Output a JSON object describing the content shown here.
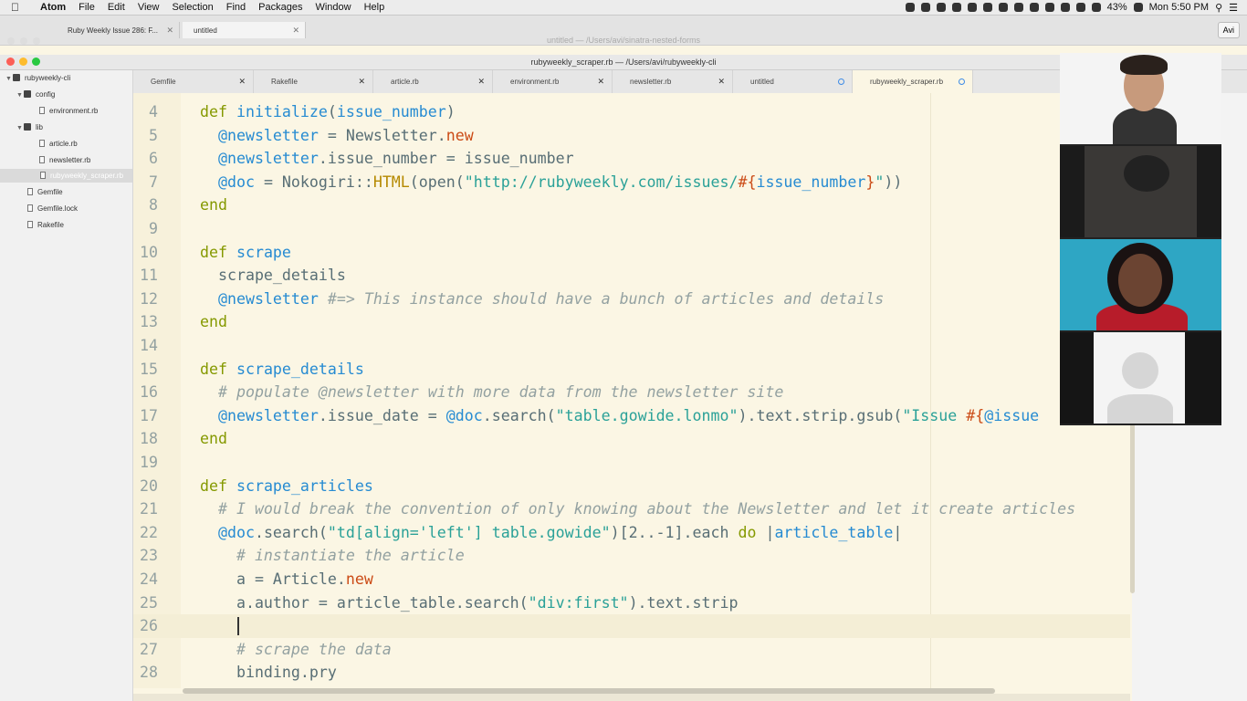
{
  "menubar": {
    "app": "Atom",
    "items": [
      "File",
      "Edit",
      "View",
      "Selection",
      "Find",
      "Packages",
      "Window",
      "Help"
    ],
    "battery": "43%",
    "clock": "Mon 5:50 PM"
  },
  "browser": {
    "tabs": [
      {
        "label": "Ruby Weekly Issue 286: F..."
      },
      {
        "label": "untitled"
      }
    ],
    "profile": "Avi",
    "untitled_path": "untitled — /Users/avi/sinatra-nested-forms"
  },
  "atom": {
    "window_title": "rubyweekly_scraper.rb — /Users/avi/rubyweekly-cli",
    "tree": {
      "root": "rubyweekly-cli",
      "config": "config",
      "environment": "environment.rb",
      "lib": "lib",
      "article": "article.rb",
      "newsletter": "newsletter.rb",
      "scraper": "rubyweekly_scraper.rb",
      "gemfile": "Gemfile",
      "gemfile_lock": "Gemfile.lock",
      "rakefile": "Rakefile"
    },
    "tabs": [
      "Gemfile",
      "Rakefile",
      "article.rb",
      "environment.rb",
      "newsletter.rb",
      "untitled",
      "rubyweekly_scraper.rb"
    ]
  },
  "editor": {
    "lines": [
      {
        "n": "4",
        "code": [
          {
            "t": "def ",
            "c": "kw"
          },
          {
            "t": "initialize",
            "c": "fn"
          },
          {
            "t": "(",
            "c": ""
          },
          {
            "t": "issue_number",
            "c": "fn"
          },
          {
            "t": ")",
            "c": ""
          }
        ]
      },
      {
        "n": "5",
        "code": [
          {
            "t": "  ",
            "c": ""
          },
          {
            "t": "@newsletter",
            "c": "iv"
          },
          {
            "t": " = Newsletter.",
            "c": ""
          },
          {
            "t": "new",
            "c": "red"
          }
        ]
      },
      {
        "n": "6",
        "code": [
          {
            "t": "  ",
            "c": ""
          },
          {
            "t": "@newsletter",
            "c": "iv"
          },
          {
            "t": ".issue_number = issue_number",
            "c": ""
          }
        ]
      },
      {
        "n": "7",
        "code": [
          {
            "t": "  ",
            "c": ""
          },
          {
            "t": "@doc",
            "c": "iv"
          },
          {
            "t": " = Nokogiri::",
            "c": ""
          },
          {
            "t": "HTML",
            "c": "cls"
          },
          {
            "t": "(open(",
            "c": ""
          },
          {
            "t": "\"http://rubyweekly.com/issues/",
            "c": "str"
          },
          {
            "t": "#{",
            "c": "red"
          },
          {
            "t": "issue_number",
            "c": "fn"
          },
          {
            "t": "}",
            "c": "red"
          },
          {
            "t": "\"",
            "c": "str"
          },
          {
            "t": "))",
            "c": ""
          }
        ]
      },
      {
        "n": "8",
        "code": [
          {
            "t": "end",
            "c": "kw"
          }
        ]
      },
      {
        "n": "9",
        "code": []
      },
      {
        "n": "10",
        "code": [
          {
            "t": "def ",
            "c": "kw"
          },
          {
            "t": "scrape",
            "c": "fn"
          }
        ]
      },
      {
        "n": "11",
        "code": [
          {
            "t": "  scrape_details",
            "c": ""
          }
        ]
      },
      {
        "n": "12",
        "code": [
          {
            "t": "  ",
            "c": ""
          },
          {
            "t": "@newsletter",
            "c": "iv"
          },
          {
            "t": " #=> This instance should have a bunch of articles and details",
            "c": "cm"
          }
        ]
      },
      {
        "n": "13",
        "code": [
          {
            "t": "end",
            "c": "kw"
          }
        ]
      },
      {
        "n": "14",
        "code": []
      },
      {
        "n": "15",
        "code": [
          {
            "t": "def ",
            "c": "kw"
          },
          {
            "t": "scrape_details",
            "c": "fn"
          }
        ]
      },
      {
        "n": "16",
        "code": [
          {
            "t": "  # populate @newsletter with more data from the newsletter site",
            "c": "cm"
          }
        ]
      },
      {
        "n": "17",
        "code": [
          {
            "t": "  ",
            "c": ""
          },
          {
            "t": "@newsletter",
            "c": "iv"
          },
          {
            "t": ".issue_date = ",
            "c": ""
          },
          {
            "t": "@doc",
            "c": "iv"
          },
          {
            "t": ".search(",
            "c": ""
          },
          {
            "t": "\"table.gowide.lonmo\"",
            "c": "str"
          },
          {
            "t": ").text.strip.gsub(",
            "c": ""
          },
          {
            "t": "\"Issue ",
            "c": "str"
          },
          {
            "t": "#{",
            "c": "red"
          },
          {
            "t": "@issue",
            "c": "iv"
          }
        ]
      },
      {
        "n": "18",
        "code": [
          {
            "t": "end",
            "c": "kw"
          }
        ]
      },
      {
        "n": "19",
        "code": []
      },
      {
        "n": "20",
        "code": [
          {
            "t": "def ",
            "c": "kw"
          },
          {
            "t": "scrape_articles",
            "c": "fn"
          }
        ]
      },
      {
        "n": "21",
        "code": [
          {
            "t": "  # I would break the convention of only knowing about the Newsletter and let it create articles",
            "c": "cm"
          }
        ]
      },
      {
        "n": "22",
        "code": [
          {
            "t": "  ",
            "c": ""
          },
          {
            "t": "@doc",
            "c": "iv"
          },
          {
            "t": ".search(",
            "c": ""
          },
          {
            "t": "\"td[align='left'] table.gowide\"",
            "c": "str"
          },
          {
            "t": ")[2..-1].each ",
            "c": ""
          },
          {
            "t": "do",
            "c": "kw"
          },
          {
            "t": " |",
            "c": ""
          },
          {
            "t": "article_table",
            "c": "fn"
          },
          {
            "t": "|",
            "c": ""
          }
        ]
      },
      {
        "n": "23",
        "code": [
          {
            "t": "    # instantiate the article",
            "c": "cm"
          }
        ]
      },
      {
        "n": "24",
        "code": [
          {
            "t": "    a = Article.",
            "c": ""
          },
          {
            "t": "new",
            "c": "red"
          }
        ]
      },
      {
        "n": "25",
        "code": [
          {
            "t": "    a.author = article_table.search(",
            "c": ""
          },
          {
            "t": "\"div:first\"",
            "c": "str"
          },
          {
            "t": ").text.strip",
            "c": ""
          }
        ]
      },
      {
        "n": "26",
        "code": [],
        "cursor": true
      },
      {
        "n": "27",
        "code": [
          {
            "t": "    # scrape the data",
            "c": "cm"
          }
        ]
      },
      {
        "n": "28",
        "code": [
          {
            "t": "    binding.pry",
            "c": ""
          }
        ]
      }
    ]
  },
  "colors": {
    "editor_bg": "#fbf6e4",
    "keyword": "#859900",
    "identifier": "#268bd2",
    "string": "#2aa198",
    "comment": "#93a1a1",
    "modified_dot": "#3d8be6"
  }
}
